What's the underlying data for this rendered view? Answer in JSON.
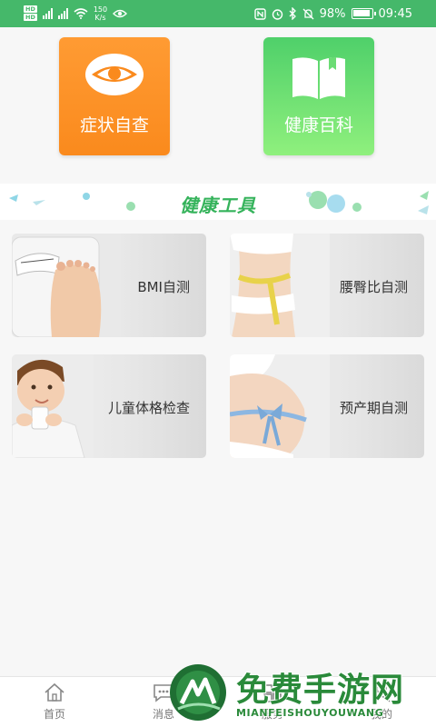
{
  "status_bar": {
    "hd_top": "HD",
    "hd_bottom": "HD",
    "net_speed_value": "150",
    "net_speed_unit": "K/s",
    "battery": "98%",
    "time": "09:45"
  },
  "top_tiles": [
    {
      "label": "症状自查",
      "icon": "eye-icon",
      "color": "#fa8a1d"
    },
    {
      "label": "健康百科",
      "icon": "book-icon",
      "color": "#4fd06a"
    }
  ],
  "banner": {
    "title": "健康工具"
  },
  "tools": [
    {
      "label": "BMI自测",
      "image": "scale-foot-photo"
    },
    {
      "label": "腰臀比自测",
      "image": "waist-tape-photo"
    },
    {
      "label": "儿童体格检查",
      "image": "child-milk-photo"
    },
    {
      "label": "预产期自测",
      "image": "pregnant-belly-photo"
    }
  ],
  "bottom_nav": [
    {
      "label": "首页",
      "icon": "home-icon"
    },
    {
      "label": "消息",
      "icon": "message-icon"
    },
    {
      "label": "服务",
      "icon": "service-icon"
    },
    {
      "label": "我的",
      "icon": "profile-icon"
    }
  ],
  "watermark": {
    "text_cn": "免费手游网",
    "text_en": "MIANFEISHOUYOUWANG"
  },
  "colors": {
    "status_bar": "#45b86a",
    "accent_green": "#35b35b",
    "orange": "#fa8a1d"
  }
}
